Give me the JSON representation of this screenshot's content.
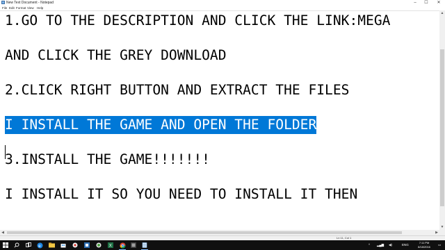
{
  "window": {
    "title": "New Text Document - Notepad",
    "controls": {
      "minimize": "–",
      "maximize": "☐",
      "close": "✕"
    }
  },
  "menu": [
    "File",
    "Edit",
    "Format",
    "View",
    "Help"
  ],
  "editor": {
    "lines": [
      "1.GO TO THE DESCRIPTION AND CLICK THE LINK:MEGA",
      "AND CLICK THE GREY DOWNLOAD",
      "2.CLICK RIGHT BUTTON AND EXTRACT THE FILES",
      "I INSTALL THE GAME AND OPEN THE FOLDER",
      "3.INSTALL THE GAME!!!!!!!",
      "I INSTALL IT SO YOU NEED TO INSTALL IT THEN"
    ],
    "selected_line_index": 3,
    "selection_color": "#0078d7"
  },
  "statusbar": {
    "position": "Ln 11, Col 1"
  },
  "taskbar": {
    "icons": [
      "windows-start-icon",
      "search-icon",
      "task-view-icon",
      "edge-icon",
      "file-explorer-icon",
      "store-icon",
      "app-icon-1",
      "app-icon-2",
      "app-icon-3",
      "excel-icon",
      "chrome-icon",
      "app-icon-4",
      "notepad-icon"
    ],
    "lang": "ENG",
    "time": "7:11 PM",
    "date": "8/18/2016"
  }
}
